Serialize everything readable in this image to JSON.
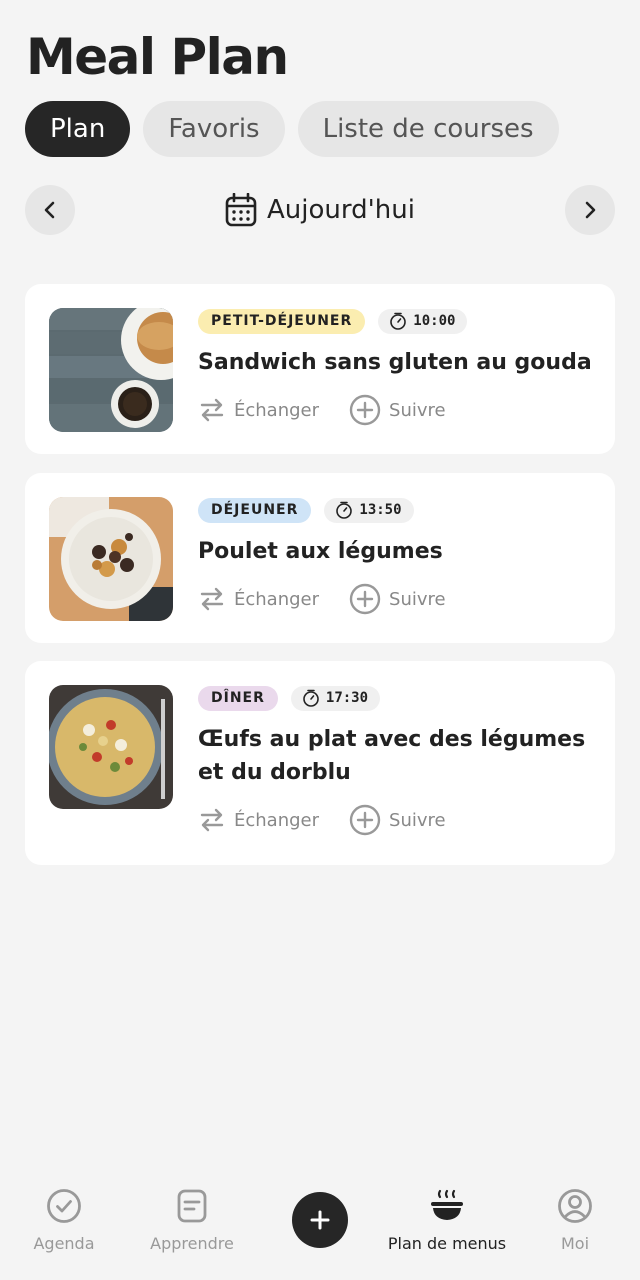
{
  "header": {
    "title": "Meal Plan"
  },
  "tabs": [
    {
      "label": "Plan",
      "active": true
    },
    {
      "label": "Favoris",
      "active": false
    },
    {
      "label": "Liste de courses",
      "active": false
    }
  ],
  "date_nav": {
    "label": "Aujourd'hui"
  },
  "meals": [
    {
      "category": "PETIT-DÉJEUNER",
      "category_color": "#fbedb0",
      "time": "10:00",
      "name": "Sandwich sans gluten au gouda",
      "swap_label": "Échanger",
      "track_label": "Suivre"
    },
    {
      "category": "DÉJEUNER",
      "category_color": "#cfe4f7",
      "time": "13:50",
      "name": "Poulet aux légumes",
      "swap_label": "Échanger",
      "track_label": "Suivre"
    },
    {
      "category": "DÎNER",
      "category_color": "#ead9ec",
      "time": "17:30",
      "name": "Œufs au plat avec des légumes et du dorblu",
      "swap_label": "Échanger",
      "track_label": "Suivre"
    }
  ],
  "bottom_nav": [
    {
      "label": "Agenda",
      "icon": "check-circle-icon",
      "active": false
    },
    {
      "label": "Apprendre",
      "icon": "document-icon",
      "active": false
    },
    {
      "label": "",
      "icon": "plus-icon",
      "active": false
    },
    {
      "label": "Plan de menus",
      "icon": "bowl-icon",
      "active": true
    },
    {
      "label": "Moi",
      "icon": "user-circle-icon",
      "active": false
    }
  ]
}
